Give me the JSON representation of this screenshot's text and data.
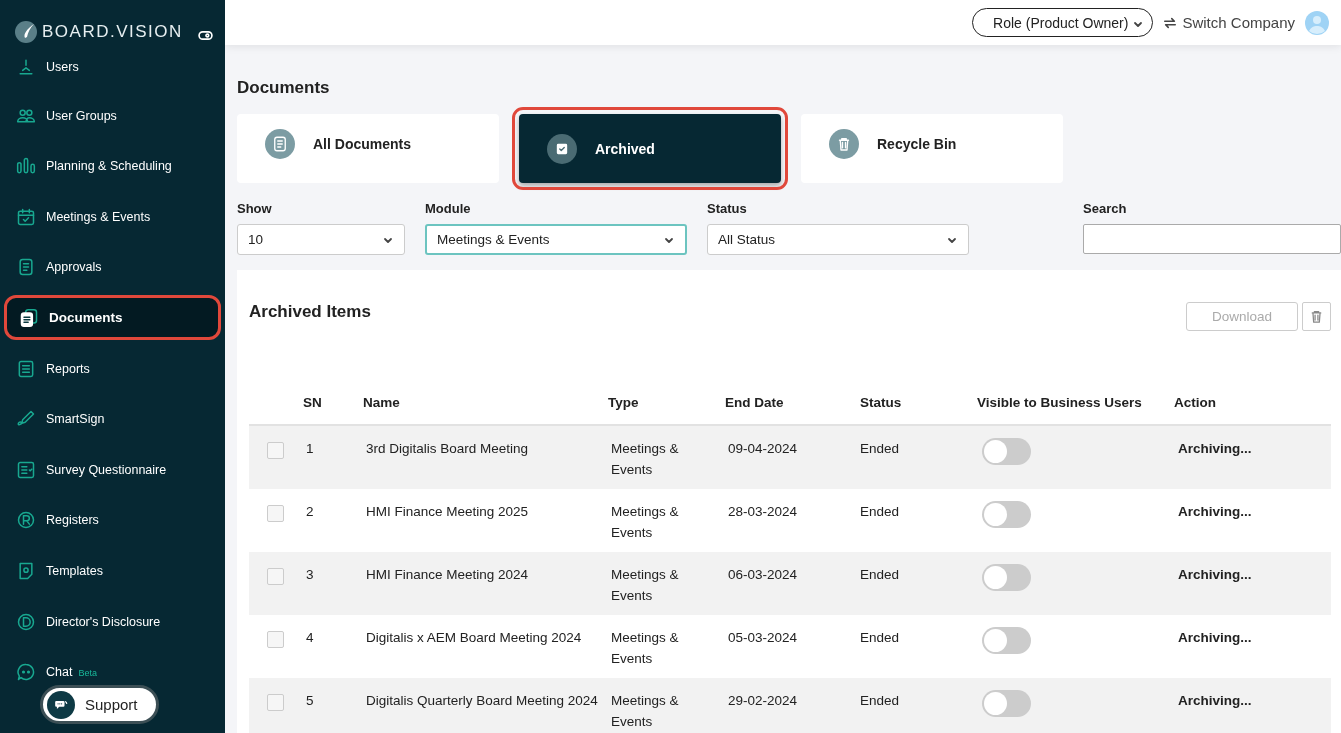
{
  "sidebar": {
    "brand": "BOARD.VISION",
    "items": [
      {
        "label": "Users",
        "selected": false
      },
      {
        "label": "User Groups",
        "selected": false
      },
      {
        "label": "Planning & Scheduling",
        "selected": false
      },
      {
        "label": "Meetings & Events",
        "selected": false
      },
      {
        "label": "Approvals",
        "selected": false
      },
      {
        "label": "Documents",
        "selected": true
      },
      {
        "label": "Reports",
        "selected": false
      },
      {
        "label": "SmartSign",
        "selected": false
      },
      {
        "label": "Survey Questionnaire",
        "selected": false
      },
      {
        "label": "Registers",
        "selected": false
      },
      {
        "label": "Templates",
        "selected": false
      },
      {
        "label": "Director's Disclosure",
        "selected": false
      },
      {
        "label": "Chat",
        "selected": false,
        "badge": "Beta"
      }
    ],
    "support": "Support"
  },
  "header": {
    "role": "Role (Product Owner)",
    "switch": "Switch Company"
  },
  "page_title": "Documents",
  "tabs": [
    {
      "label": "All Documents",
      "selected": false
    },
    {
      "label": "Archived",
      "selected": true
    },
    {
      "label": "Recycle Bin",
      "selected": false
    }
  ],
  "filters": [
    {
      "label": "Show",
      "value": "10",
      "focused": false
    },
    {
      "label": "Module",
      "value": "Meetings & Events",
      "focused": true
    },
    {
      "label": "Status",
      "value": "All Status",
      "focused": false
    }
  ],
  "search": {
    "label": "Search"
  },
  "section_title": "Archived Items",
  "download": {
    "label": "Download",
    "disabled": true
  },
  "table": {
    "columns": [
      "SN",
      "Name",
      "Type",
      "End Date",
      "Status",
      "Visible to Business Users",
      "Action"
    ],
    "rows": [
      {
        "checked": false,
        "sn": "1",
        "name": "3rd Digitalis Board Meeting",
        "type": "Meetings & Events",
        "end_date": "09-04-2024",
        "status": "Ended",
        "visible": false,
        "action": "Archiving..."
      },
      {
        "checked": false,
        "sn": "2",
        "name": "HMI Finance Meeting 2025",
        "type": "Meetings & Events",
        "end_date": "28-03-2024",
        "status": "Ended",
        "visible": false,
        "action": "Archiving..."
      },
      {
        "checked": false,
        "sn": "3",
        "name": "HMI Finance Meeting 2024",
        "type": "Meetings & Events",
        "end_date": "06-03-2024",
        "status": "Ended",
        "visible": false,
        "action": "Archiving..."
      },
      {
        "checked": false,
        "sn": "4",
        "name": "Digitalis x AEM Board Meeting 2024",
        "type": "Meetings & Events",
        "end_date": "05-03-2024",
        "status": "Ended",
        "visible": false,
        "action": "Archiving..."
      },
      {
        "checked": false,
        "sn": "5",
        "name": "Digitalis Quarterly Board Meeting 2024",
        "type": "Meetings & Events",
        "end_date": "29-02-2024",
        "status": "Ended",
        "visible": false,
        "action": "Archiving..."
      }
    ]
  }
}
